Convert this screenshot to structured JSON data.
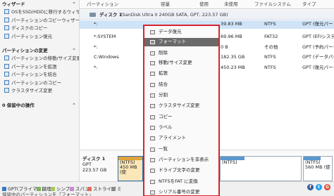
{
  "sidebar": {
    "wizard_header": "ウィザード",
    "wizard_items": [
      "OSをSSD/HDDに移行するウィザード",
      "パーティションのコピーウィザード",
      "ディスクのコピー",
      "パーティション復元"
    ],
    "change_header": "パーティションの変更",
    "change_items": [
      "パーティションの移動/サイズ変更",
      "パーティションを拡張",
      "パーティションを結合",
      "パーティションのコピー",
      "クラスタサイズ変更"
    ],
    "pending_header": "0 保留中の操作"
  },
  "columns": [
    "パーティション",
    "容量",
    "使用",
    "未使用",
    "ファイルシステム",
    "タイプ"
  ],
  "disk1_label": "ディスク 1",
  "disk1_detail": "(SanDisk Ultra II 240GB SATA, GPT, 223.57 GB)",
  "rows": [
    {
      "part": "*:",
      "unused": "39.83 MB",
      "fs": "NTFS",
      "type": "GPT (復元パー"
    },
    {
      "part": "*:SYSTEM",
      "unused": "69.96 MB",
      "fs": "FAT32",
      "type": "GPT (EFIシステ"
    },
    {
      "part": "*:",
      "unused": "0 B",
      "fs": "その他",
      "type": "GPT (予約パーテ"
    },
    {
      "part": "C:Windows",
      "unused": "182.35 GB",
      "fs": "NTFS",
      "type": "GPT (データパー"
    },
    {
      "part": "*:",
      "unused": "450.23 MB",
      "fs": "NTFS",
      "type": "GPT (復元パーテ"
    }
  ],
  "diskmap": {
    "name": "ディスク 1",
    "scheme": "GPT",
    "size": "223.57 GB",
    "selected_fs": "(NTFS)",
    "selected_size": "450 MB (使",
    "part3_fs": "(NTFS)",
    "part4_fs": "(NTFS)",
    "part4_size": "560 MB (使"
  },
  "context_menu": {
    "items": [
      "データ復元",
      "フォーマット",
      "削除",
      "移動/サイズ変更",
      "拡張",
      "結合",
      "分割",
      "クラスタサイズ変更",
      "コピー",
      "ラベル",
      "アライメント",
      "一覧",
      "パーティションを非表示",
      "ドライブ文字の変更",
      "NTFSをFAT に変換",
      "シリアル番号の変更"
    ],
    "highlighted_index": 1
  },
  "legend": {
    "items": [
      "GPT(プライマリ)",
      "論理",
      "シンプル",
      "スパン",
      "ストライプ",
      "ミ"
    ],
    "colors": [
      "#3b78c4",
      "#7db35a",
      "#a6c95a",
      "#c98bd0",
      "#e06b5a",
      "#8a8a8a"
    ]
  },
  "status_text": "保留中のパーティションを「フォーマット」",
  "social": [
    "f",
    "t",
    "G"
  ],
  "colors": {
    "menu_border": "#d7242f",
    "highlight": "#6a6a6a",
    "selected_row": "#cfe4f7"
  }
}
